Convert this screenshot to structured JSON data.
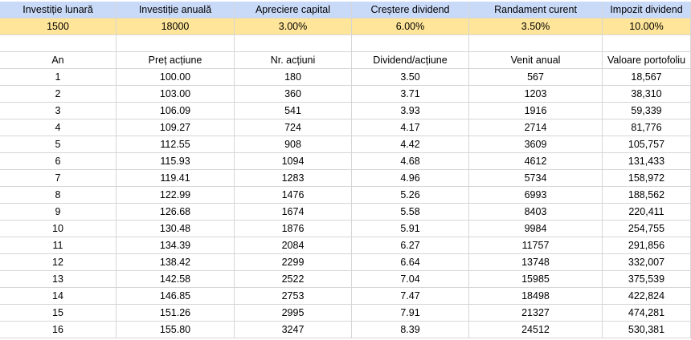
{
  "inputs": {
    "headers": [
      "Investiție lunară",
      "Investiție anuală",
      "Apreciere capital",
      "Creștere dividend",
      "Randament curent",
      "Impozit dividend"
    ],
    "values": [
      "1500",
      "18000",
      "3.00%",
      "6.00%",
      "3.50%",
      "10.00%"
    ]
  },
  "table": {
    "headers": [
      "An",
      "Preț acțiune",
      "Nr. acțiuni",
      "Dividend/acțiune",
      "Venit anual",
      "Valoare portofoliu"
    ],
    "rows": [
      [
        "1",
        "100.00",
        "180",
        "3.50",
        "567",
        "18,567"
      ],
      [
        "2",
        "103.00",
        "360",
        "3.71",
        "1203",
        "38,310"
      ],
      [
        "3",
        "106.09",
        "541",
        "3.93",
        "1916",
        "59,339"
      ],
      [
        "4",
        "109.27",
        "724",
        "4.17",
        "2714",
        "81,776"
      ],
      [
        "5",
        "112.55",
        "908",
        "4.42",
        "3609",
        "105,757"
      ],
      [
        "6",
        "115.93",
        "1094",
        "4.68",
        "4612",
        "131,433"
      ],
      [
        "7",
        "119.41",
        "1283",
        "4.96",
        "5734",
        "158,972"
      ],
      [
        "8",
        "122.99",
        "1476",
        "5.26",
        "6993",
        "188,562"
      ],
      [
        "9",
        "126.68",
        "1674",
        "5.58",
        "8403",
        "220,411"
      ],
      [
        "10",
        "130.48",
        "1876",
        "5.91",
        "9984",
        "254,755"
      ],
      [
        "11",
        "134.39",
        "2084",
        "6.27",
        "11757",
        "291,856"
      ],
      [
        "12",
        "138.42",
        "2299",
        "6.64",
        "13748",
        "332,007"
      ],
      [
        "13",
        "142.58",
        "2522",
        "7.04",
        "15985",
        "375,539"
      ],
      [
        "14",
        "146.85",
        "2753",
        "7.47",
        "18498",
        "422,824"
      ],
      [
        "15",
        "151.26",
        "2995",
        "7.91",
        "21327",
        "474,281"
      ],
      [
        "16",
        "155.80",
        "3247",
        "8.39",
        "24512",
        "530,381"
      ]
    ]
  }
}
